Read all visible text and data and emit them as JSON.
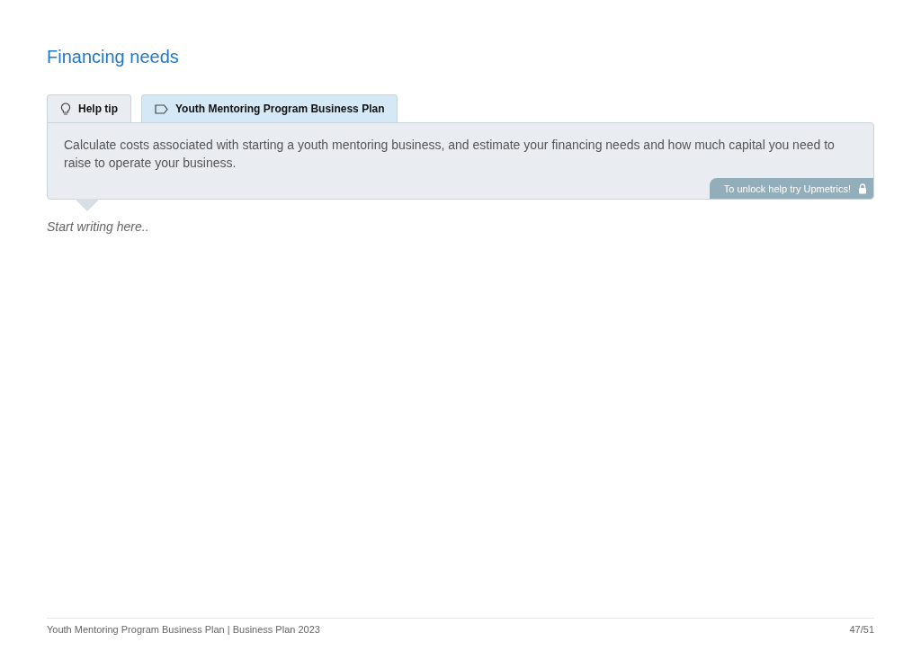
{
  "title": "Financing needs",
  "tabs": [
    {
      "label": "Help tip",
      "kind": "tip",
      "selected": true
    },
    {
      "label": "Youth Mentoring Program Business Plan",
      "kind": "tag",
      "selected": false
    }
  ],
  "help_text": "Calculate costs associated with starting a youth mentoring business, and estimate your financing needs and how much capital you need to raise to operate your business.",
  "unlock_badge": "To unlock help try Upmetrics!",
  "editor": {
    "placeholder": "Start writing here.."
  },
  "footer": {
    "document": "Youth Mentoring Program Business Plan | Business Plan 2023",
    "page": "47/51"
  }
}
